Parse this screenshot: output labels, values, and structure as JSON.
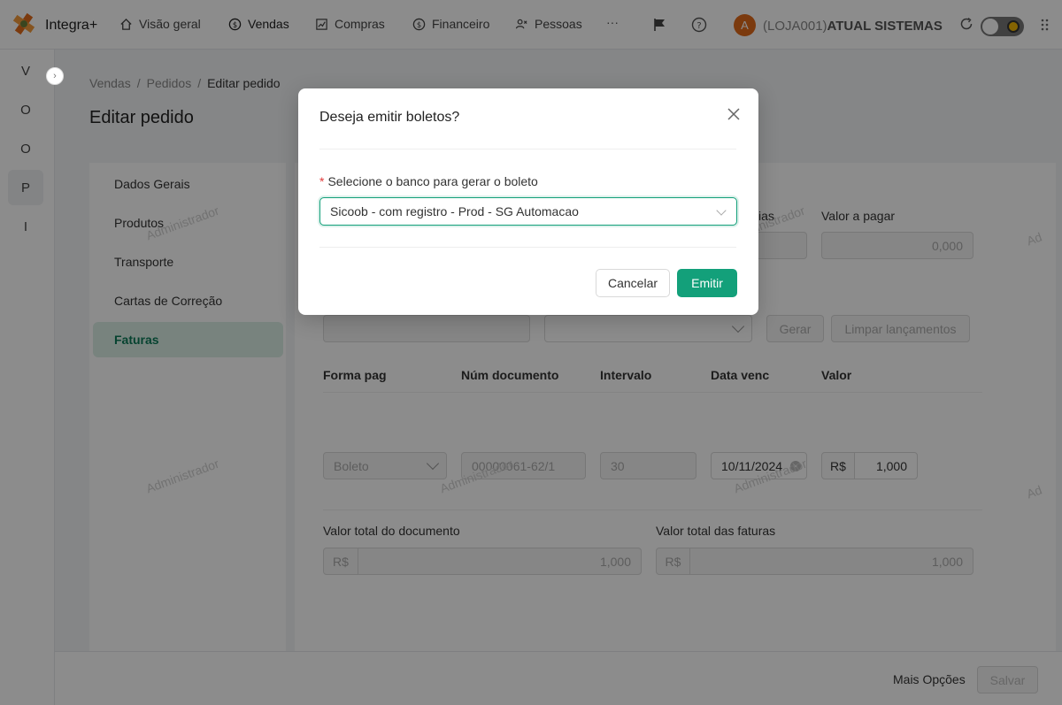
{
  "app": {
    "title": "Integra+"
  },
  "nav": [
    {
      "label": "Visão geral",
      "icon": "home-icon"
    },
    {
      "label": "Vendas",
      "icon": "dollar-icon"
    },
    {
      "label": "Compras",
      "icon": "chart-icon"
    },
    {
      "label": "Financeiro",
      "icon": "dollar-icon"
    },
    {
      "label": "Pessoas",
      "icon": "people-icon"
    }
  ],
  "nav_more": "···",
  "user": {
    "avatar_letter": "A",
    "store_prefix": "(LOJA001)",
    "store_name": "ATUAL SISTEMAS"
  },
  "rail": [
    "V",
    "O",
    "O",
    "P",
    "I"
  ],
  "breadcrumb": [
    "Vendas",
    "Pedidos",
    "Editar pedido"
  ],
  "breadcrumb_sep": "/",
  "page_title": "Editar pedido",
  "side_menu": [
    "Dados Gerais",
    "Produtos",
    "Transporte",
    "Cartas de Correção",
    "Faturas"
  ],
  "content": {
    "label_dias_partial": "ias",
    "label_valor_pagar": "Valor a pagar",
    "valor_pagar": "0,000",
    "btn_gerar": "Gerar",
    "btn_limpar": "Limpar lançamentos",
    "table_headers": [
      "Forma pag",
      "Núm documento",
      "Intervalo",
      "Data venc",
      "Valor"
    ],
    "row": {
      "forma_pag": "Boleto",
      "num_documento": "00000061-62/1",
      "intervalo": "30",
      "data_venc": "10/11/2024",
      "currency": "R$",
      "valor": "1,000"
    },
    "label_total_doc": "Valor total do documento",
    "total_doc": "1,000",
    "label_total_faturas": "Valor total das faturas",
    "total_faturas": "1,000",
    "currency": "R$"
  },
  "watermark": "Administrador",
  "watermark_partial": "Ad",
  "footer": {
    "more_options": "Mais Opções",
    "save": "Salvar"
  },
  "modal": {
    "title": "Deseja emitir boletos?",
    "required_mark": "*",
    "bank_label": "Selecione o banco para gerar o boleto",
    "bank_selected": "Sicoob - com registro - Prod - SG Automacao",
    "cancel": "Cancelar",
    "emit": "Emitir"
  },
  "colors": {
    "accent": "#13a07a",
    "avatar": "#e06a1b"
  }
}
